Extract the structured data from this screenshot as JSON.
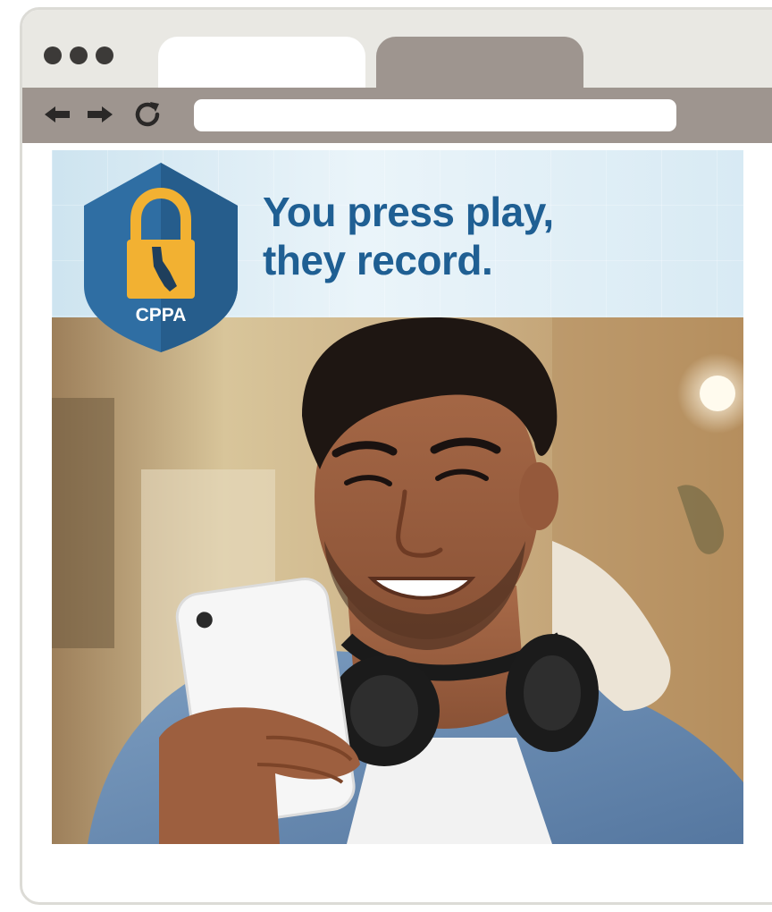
{
  "browser": {
    "window_dots": 3,
    "address": {
      "value": "",
      "placeholder": ""
    },
    "icons": {
      "back": "arrow-left-icon",
      "forward": "arrow-right-icon",
      "reload": "reload-icon"
    }
  },
  "banner": {
    "headline_line1": "You press play,",
    "headline_line2": "they record.",
    "logo_text": "CPPA",
    "colors": {
      "shield": "#2f6ea3",
      "lock": "#f2b132",
      "headline": "#1f5f93"
    }
  },
  "photo": {
    "subject": "person-smiling-at-phone-image"
  }
}
